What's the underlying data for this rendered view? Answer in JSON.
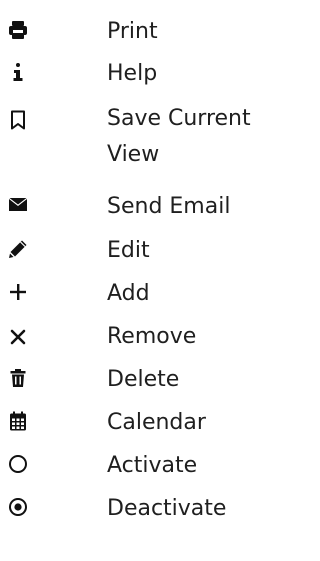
{
  "menu": {
    "items": [
      {
        "label": "Print",
        "icon": "print-icon"
      },
      {
        "label": "Help",
        "icon": "info-icon"
      },
      {
        "label": "Save Current View",
        "icon": "bookmark-icon"
      },
      {
        "label": "Send Email",
        "icon": "envelope-icon"
      },
      {
        "label": "Edit",
        "icon": "pencil-icon"
      },
      {
        "label": "Add",
        "icon": "plus-icon"
      },
      {
        "label": "Remove",
        "icon": "close-icon"
      },
      {
        "label": "Delete",
        "icon": "trash-icon"
      },
      {
        "label": "Calendar",
        "icon": "calendar-icon"
      },
      {
        "label": "Activate",
        "icon": "circle-icon"
      },
      {
        "label": "Deactivate",
        "icon": "radio-dot-icon"
      }
    ]
  },
  "colors": {
    "text": "#1f1f1f",
    "icon": "#111111"
  }
}
